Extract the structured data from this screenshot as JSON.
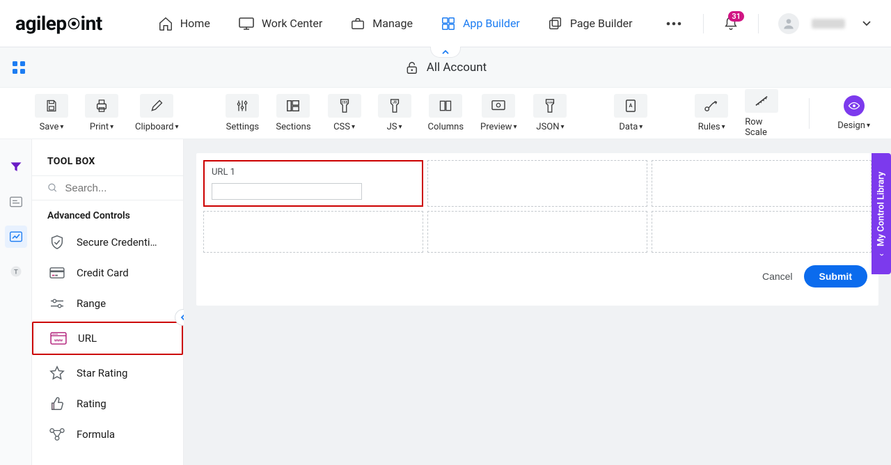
{
  "nav": {
    "logoA": "agilep",
    "logoB": "int",
    "home": "Home",
    "workcenter": "Work Center",
    "manage": "Manage",
    "appbuilder": "App Builder",
    "pagebuilder": "Page Builder",
    "notifications": "31"
  },
  "crumb": {
    "title": "All Account"
  },
  "toolbar": {
    "save": "Save",
    "print": "Print",
    "clipboard": "Clipboard",
    "settings": "Settings",
    "sections": "Sections",
    "css": "CSS",
    "js": "JS",
    "columns": "Columns",
    "preview": "Preview",
    "json": "JSON",
    "data": "Data",
    "rules": "Rules",
    "rowscale": "Row Scale",
    "design": "Design"
  },
  "toolbox": {
    "title": "TOOL BOX",
    "search_placeholder": "Search...",
    "group": "Advanced Controls",
    "items": {
      "secure": "Secure Credenti…",
      "credit": "Credit Card",
      "range": "Range",
      "url": "URL",
      "star": "Star Rating",
      "rating": "Rating",
      "formula": "Formula"
    }
  },
  "canvas": {
    "field_label": "URL 1",
    "cancel": "Cancel",
    "submit": "Submit"
  },
  "dock": {
    "label": "My Control Library"
  }
}
